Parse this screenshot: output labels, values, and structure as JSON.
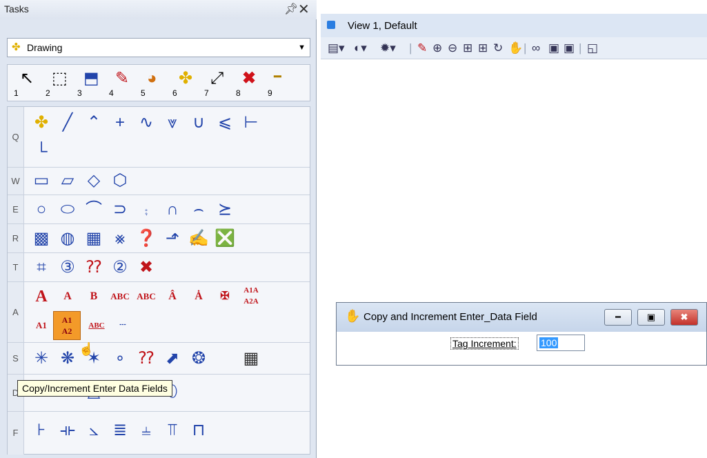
{
  "tasks_panel": {
    "title": "Tasks",
    "pin_glyph": "4",
    "close_glyph": "✕",
    "task_selector": {
      "value": "Drawing",
      "icon": "bulb-icon"
    },
    "main_tools": [
      {
        "number": "1",
        "icon": "arrow-select-icon"
      },
      {
        "number": "2",
        "icon": "fence-icon"
      },
      {
        "number": "3",
        "icon": "move-copy-icon"
      },
      {
        "number": "4",
        "icon": "paint-brush-icon"
      },
      {
        "number": "5",
        "icon": "palette-icon"
      },
      {
        "number": "6",
        "icon": "element-info-icon"
      },
      {
        "number": "7",
        "icon": "scale-icon"
      },
      {
        "number": "8",
        "icon": "delete-icon"
      },
      {
        "number": "9",
        "icon": "measure-icon"
      }
    ],
    "groups": [
      {
        "key": "Q"
      },
      {
        "key": "W"
      },
      {
        "key": "E"
      },
      {
        "key": "R"
      },
      {
        "key": "T"
      },
      {
        "key": "A"
      },
      {
        "key": "S"
      },
      {
        "key": "D"
      },
      {
        "key": "F"
      }
    ],
    "text_tools": {
      "place_text": "A",
      "fit_text": "A",
      "copy_increment": "B",
      "spell_check": "ABC",
      "find_replace": "ABC",
      "increment_top": "A1A",
      "increment_bottom": "A2A",
      "text_node_a1": "A1",
      "active_top": "A1",
      "active_bottom": "A2",
      "abc_field": "ABC"
    },
    "tooltip": "Copy/Increment Enter Data Fields"
  },
  "view": {
    "title": "View 1, Default",
    "accent": "#2a7de1"
  },
  "dialog": {
    "title": "Copy and Increment Enter_Data Field",
    "tag_increment_label": "Tag Increment:",
    "tag_increment_value": "100",
    "close_color": "#c3312a"
  }
}
